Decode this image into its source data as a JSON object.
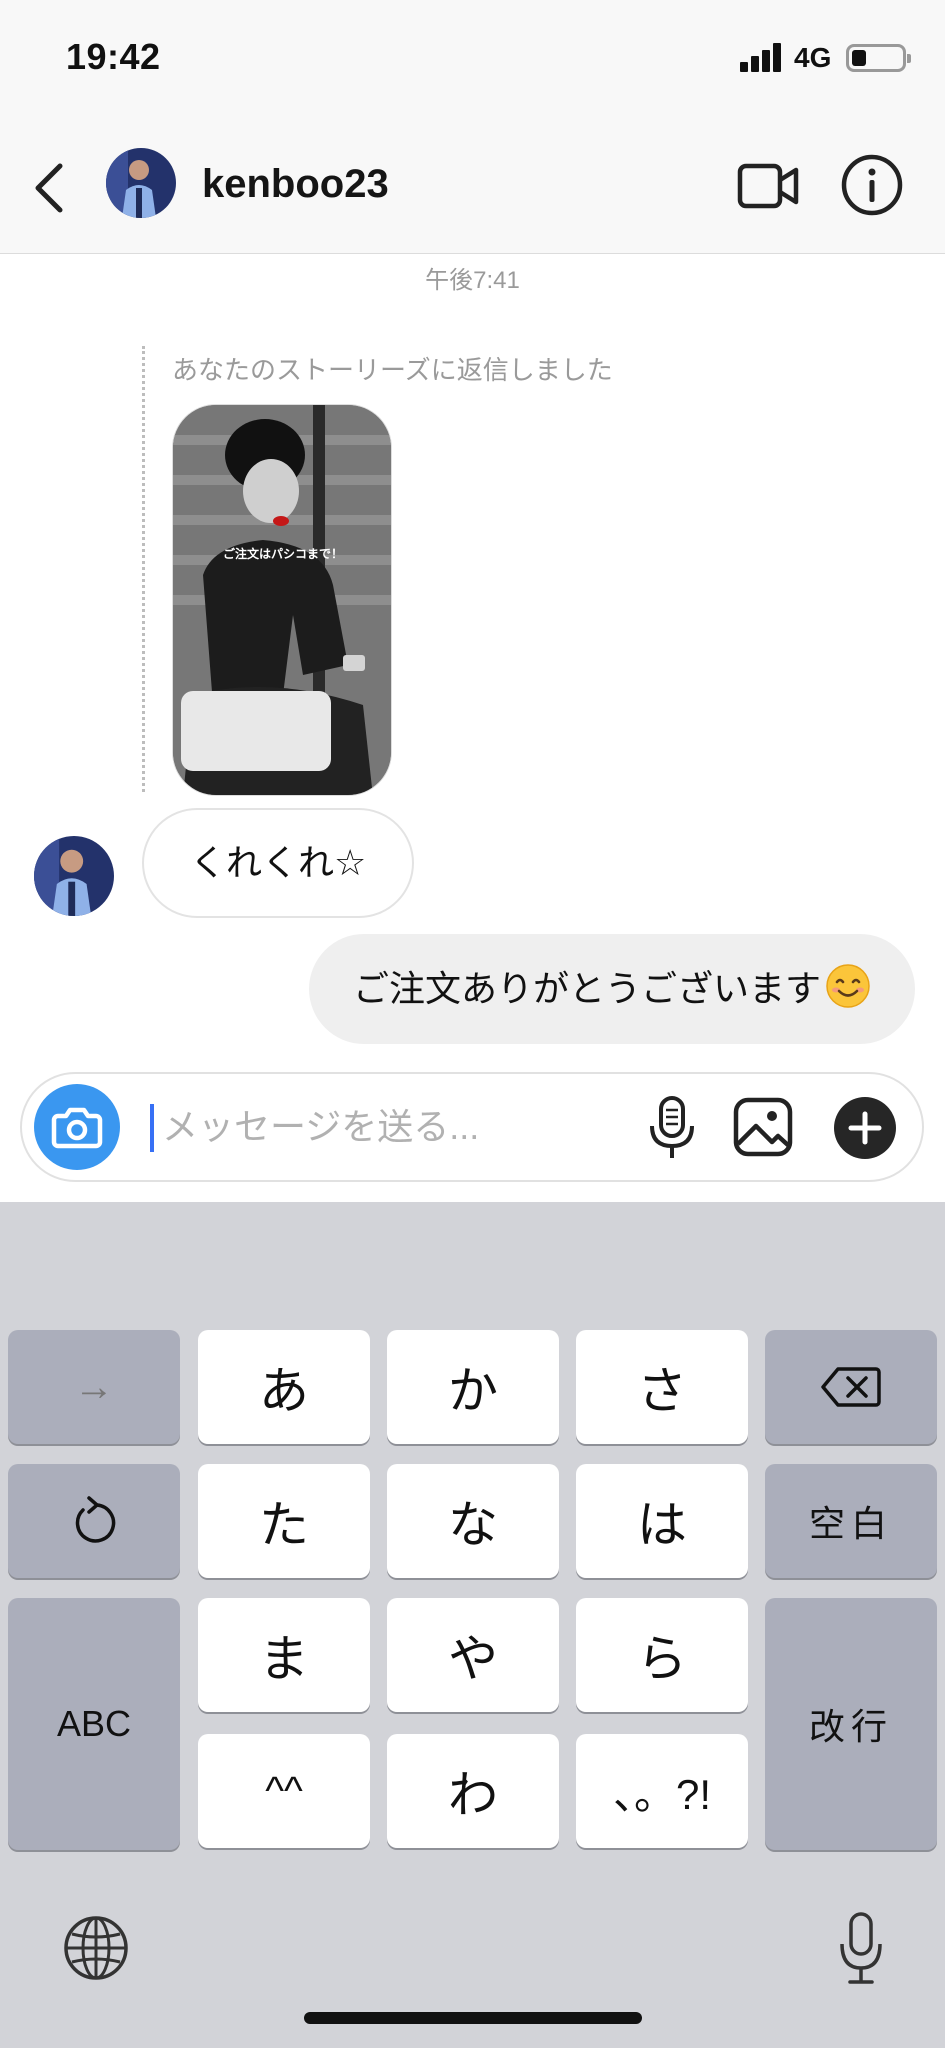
{
  "status_bar": {
    "time": "19:42",
    "network": "4G",
    "icons": [
      "signal-icon",
      "battery-icon"
    ]
  },
  "header": {
    "username": "kenboo23",
    "icons": [
      "back-icon",
      "avatar",
      "video-call-icon",
      "info-icon"
    ]
  },
  "conversation": {
    "timestamp": "午後7:41",
    "story_reply_label": "あなたのストーリーズに返信しました",
    "story_caption": "ご注文はパシコまで！",
    "messages": [
      {
        "direction": "incoming",
        "text": "くれくれ☆"
      },
      {
        "direction": "outgoing",
        "text": "ご注文ありがとうございます",
        "emoji": "smiling-face-emoji"
      }
    ]
  },
  "composer": {
    "placeholder": "メッセージを送る...",
    "icons": [
      "camera-icon",
      "microphone-icon",
      "gallery-icon",
      "plus-icon"
    ],
    "accent_color": "#3a97f0"
  },
  "keyboard": {
    "rows": [
      [
        "→",
        "あ",
        "か",
        "さ",
        "delete-icon"
      ],
      [
        "undo-icon",
        "た",
        "な",
        "は",
        "空白"
      ],
      [
        "ABC",
        "ま",
        "や",
        "ら",
        "改行"
      ],
      [
        "^^",
        "わ",
        "、。?!"
      ]
    ],
    "keys": {
      "arrow": "→",
      "a": "あ",
      "ka": "か",
      "sa": "さ",
      "ta": "た",
      "na": "な",
      "ha": "は",
      "space": "空白",
      "abc": "ABC",
      "ma": "ま",
      "ya": "や",
      "ra": "ら",
      "return": "改行",
      "kaomoji": "^^",
      "wa": "わ",
      "punct": "、。?!"
    },
    "bottom_icons": [
      "globe-icon",
      "dictation-mic-icon"
    ]
  }
}
